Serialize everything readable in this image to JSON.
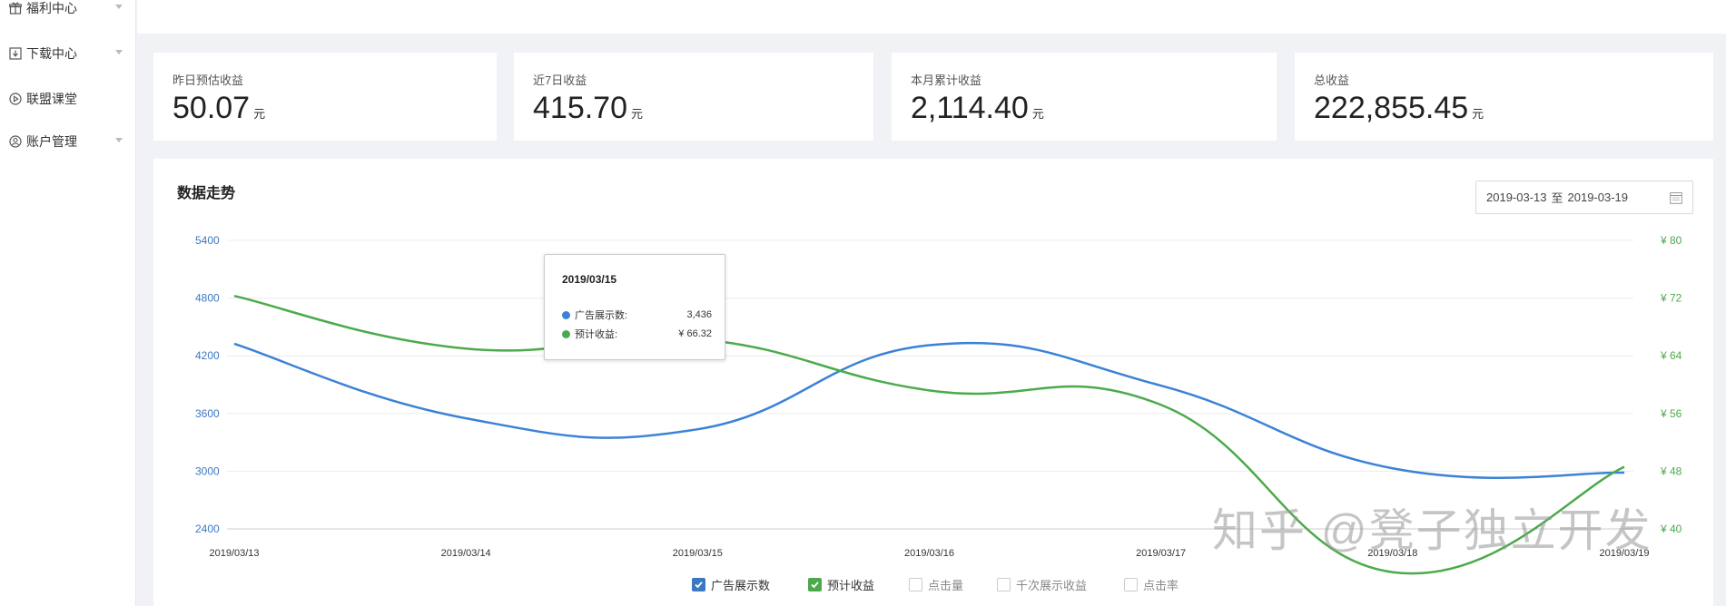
{
  "sidebar": {
    "items": [
      {
        "label": "福利中心",
        "icon": "gift-icon",
        "has_chevron": true
      },
      {
        "label": "下载中心",
        "icon": "download-icon",
        "has_chevron": true
      },
      {
        "label": "联盟课堂",
        "icon": "play-circle-icon",
        "has_chevron": false
      },
      {
        "label": "账户管理",
        "icon": "user-circle-icon",
        "has_chevron": true
      }
    ]
  },
  "cards": [
    {
      "title": "昨日预估收益",
      "value": "50.07",
      "unit": "元"
    },
    {
      "title": "近7日收益",
      "value": "415.70",
      "unit": "元"
    },
    {
      "title": "本月累计收益",
      "value": "2,114.40",
      "unit": "元"
    },
    {
      "title": "总收益",
      "value": "222,855.45",
      "unit": "元"
    }
  ],
  "panel": {
    "title": "数据走势",
    "date_start": "2019-03-13",
    "date_sep": "至",
    "date_end": "2019-03-19"
  },
  "tooltip": {
    "title": "2019/03/15",
    "rows": [
      {
        "label": "广告展示数:",
        "value": "3,436",
        "color": "#3b82d6"
      },
      {
        "label": "预计收益:",
        "value": "¥ 66.32",
        "color": "#4caa4c"
      }
    ]
  },
  "legend": [
    {
      "label": "广告展示数",
      "checked": true,
      "color": "#3a78c3"
    },
    {
      "label": "预计收益",
      "checked": true,
      "color": "#4caa4c"
    },
    {
      "label": "点击量",
      "checked": false
    },
    {
      "label": "千次展示收益",
      "checked": false
    },
    {
      "label": "点击率",
      "checked": false
    }
  ],
  "colors": {
    "blue": "#3b82d6",
    "green": "#4caa4c",
    "tick_blue": "#3a78c3"
  },
  "watermark": "知乎 @凳子独立开发",
  "chart_data": {
    "type": "line",
    "categories": [
      "2019/03/13",
      "2019/03/14",
      "2019/03/15",
      "2019/03/16",
      "2019/03/17",
      "2019/03/18",
      "2019/03/19"
    ],
    "series": [
      {
        "name": "广告展示数",
        "axis": "left",
        "color": "#3b82d6",
        "values": [
          4325,
          3550,
          3436,
          4310,
          3890,
          3030,
          2985
        ]
      },
      {
        "name": "预计收益",
        "axis": "right",
        "color": "#4caa4c",
        "values": [
          72.3,
          65.0,
          66.32,
          59.2,
          57.2,
          34.0,
          48.6
        ]
      }
    ],
    "y_left": {
      "ticks": [
        "2400",
        "3000",
        "3600",
        "4200",
        "4800",
        "5400"
      ],
      "min": 2400,
      "max": 5400
    },
    "y_right": {
      "ticks": [
        "¥ 40",
        "¥ 48",
        "¥ 56",
        "¥ 64",
        "¥ 72",
        "¥ 80"
      ],
      "min": 40,
      "max": 80
    },
    "grid": true,
    "legend_position": "bottom"
  }
}
